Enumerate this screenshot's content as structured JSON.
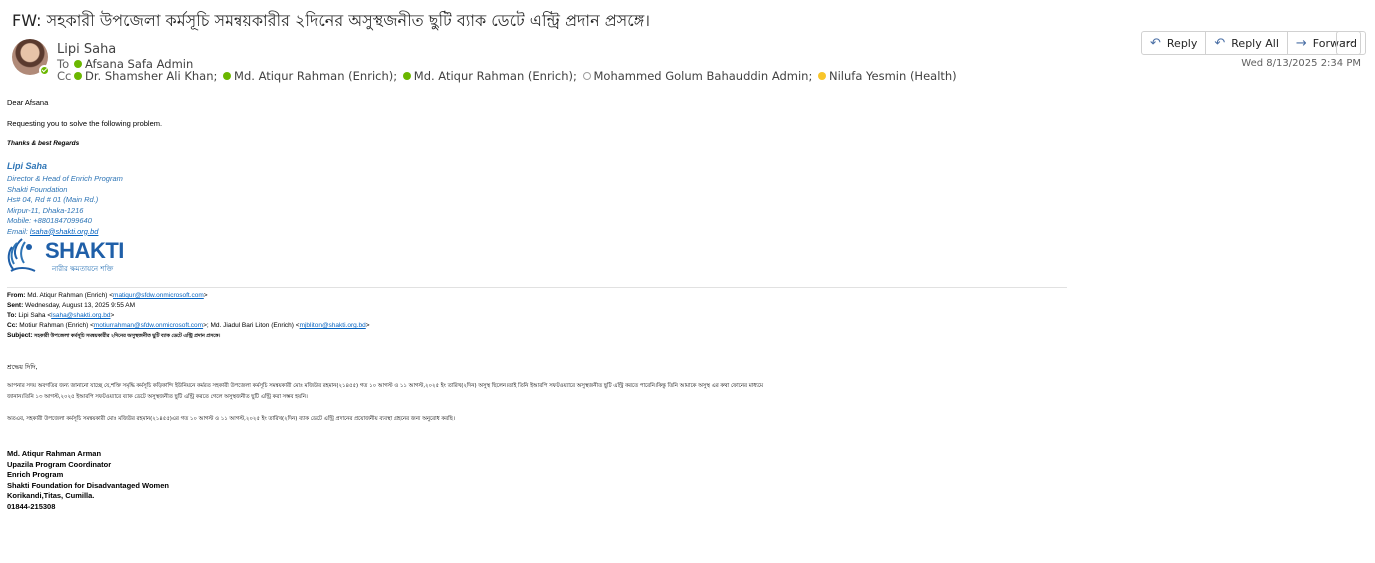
{
  "subject": "FW: সহকারী উপজেলা কর্মসূচি সমন্বয়কারীর ২দিনের অসুস্থজনীত ছুটি ব্যাক ডেটে  এন্ট্রি প্রদান প্রসঙ্গে।",
  "sender": {
    "name": "Lipi Saha",
    "presence": "available"
  },
  "to": {
    "label": "To",
    "recipients": [
      {
        "name": "Afsana Safa Admin",
        "presence": "available"
      }
    ]
  },
  "cc": {
    "label": "Cc",
    "recipients": [
      {
        "name": "Dr. Shamsher  Ali Khan;",
        "presence": "available"
      },
      {
        "name": "Md. Atiqur Rahman (Enrich);",
        "presence": "available"
      },
      {
        "name": "Md. Atiqur Rahman (Enrich);",
        "presence": "available"
      },
      {
        "name": "Mohammed Golum Bahauddin Admin;",
        "presence": "offline"
      },
      {
        "name": "Nilufa Yesmin (Health)",
        "presence": "away"
      }
    ]
  },
  "actions": {
    "reply": "Reply",
    "reply_all": "Reply All",
    "forward": "Forward",
    "more": "···"
  },
  "date": "Wed 8/13/2025 2:34 PM",
  "body": {
    "greeting": "Dear Afsana",
    "request": "Requesting you to solve the following problem.",
    "thanks": "Thanks & best Regards",
    "signature": {
      "name": "Lipi Saha",
      "title": "Director & Head of Enrich Program",
      "org": "Shakti Foundation",
      "address1": "Hs# 04, Rd # 01 (Main Rd.)",
      "address2": "Mirpur-11, Dhaka-1216",
      "mobile": "Mobile: +8801847099640",
      "email_label": "Email: ",
      "email": "lsaha@shakti.org.bd"
    },
    "logo": {
      "word": "SHAKTI",
      "tagline": "নারীর ক্ষমতায়নে শক্তি"
    }
  },
  "forwarded": {
    "from_label": "From:",
    "from": " Md. Atiqur Rahman (Enrich) <",
    "from_email": "matiqur@sfdw.onmicrosoft.com",
    "sent_label": "Sent:",
    "sent": " Wednesday, August 13, 2025 9:55 AM",
    "to_label": "To:",
    "to": " Lipi Saha <",
    "to_email": "lsaha@shakti.org.bd",
    "cc_label": "Cc:",
    "cc": " Motiur Rahman (Enrich) <",
    "cc_email1": "motiurrahman@sfdw.onmicrosoft.com",
    "cc_mid": ">; Md. Jiadul Bari Liton (Enrich) <",
    "cc_email2": "mjbliton@shakti.org.bd",
    "subject_label": "Subject:",
    "subject": " সহকারী উপজেলা কর্মসূচি সমন্বয়কারীর ২দিনের অসুস্থজনীত ছুটি ব্যাক ডেটে এন্ট্রি প্রদান প্রসঙ্গে।",
    "salutation": "শ্রদ্ধেয় দিদি,",
    "para1_line1": "আপনার সদয় অবগতির জন্য জানানো যাচ্ছে যে,শক্তি সমৃদ্ধি কর্মসূচি কড়িকান্দি ইউনিয়নে কর্মরত সহকারী উপজেলা কর্মসূচি সমন্বয়কারী মোঃ মজিউর রহমান(২১৪৫৫) গত ১০ আগস্ট ও ১১ আগস্ট,২০২৫ ইং তারিখ(২দিন) অসুস্থ ছিলেন।তাই তিনি ইআরপি সফটওয়্যারে অসুস্থজনীত ছুটি এন্ট্রি করতে পারেনি।কিন্তু তিনি আমাকে অসুস্থ এর কথা ফোনের মাধ্যমে",
    "para1_line2": "জানান।তিনি ১৩ আগস্ট,২০২৫ ইআরপি সফটওয়্যারে ব্যাক ডেটে অসুস্থজনীত ছুটি এন্ট্রি করতে গেলে অসুস্থজনীত ছুটি এন্ট্রি করা সম্ভব হয়নি।",
    "para2": "অতএব, সহকারী উপজেলা কর্মসূচি সমন্বয়কারী মোঃ মজিউর রহমান(২১৪৫৫)এর গত ১০ আগস্ট ও ১১ আগস্ট,২০২৫ ইং তারিখ(২দিন) ব্যাক ডেটে এন্ট্রি প্রদানের প্রয়োজনীয় ব্যবস্থা গ্রহনের জন্য অনুরোধ করছি।",
    "signature": [
      "Md. Atiqur Rahman Arman",
      "Upazila  Program Coordinator",
      "Enrich  Program",
      "Shakti Foundation for Disadvantaged Women",
      "Korikandi,Titas, Cumilla.",
      "01844-215308"
    ]
  },
  "colors": {
    "accent": "#4a6fa5",
    "signature_blue": "#2e75b6",
    "link": "#0563c1",
    "available": "#6bb700",
    "away": "#f8c52a"
  }
}
